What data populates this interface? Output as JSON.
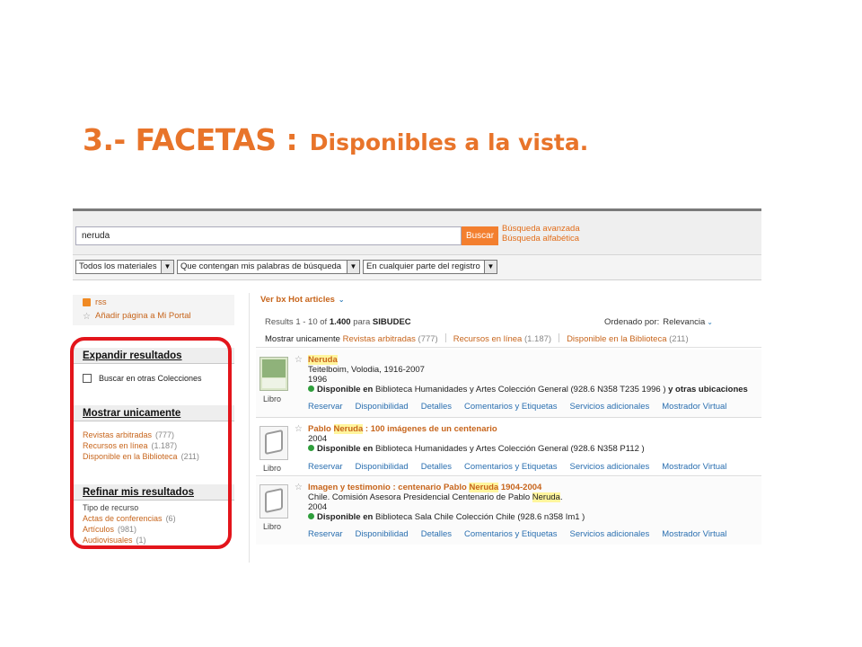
{
  "slide": {
    "title": "3.- FACETAS :",
    "subtitle": "Disponibles a la vista."
  },
  "search": {
    "query": "neruda",
    "button": "Buscar",
    "links": [
      "Búsqueda avanzada",
      "Búsqueda alfabética"
    ],
    "selects": [
      "Todos los materiales",
      "Que contengan mis palabras de búsqueda",
      "En cualquier parte del registro"
    ]
  },
  "sidebar": {
    "rss": "rss",
    "portal": "Añadir página a Mi Portal",
    "expand": {
      "heading": "Expandir resultados",
      "checkbox_label": "Buscar en otras Colecciones"
    },
    "show_only": {
      "heading": "Mostrar unicamente",
      "items": [
        {
          "label": "Revistas arbitradas",
          "count": "(777)"
        },
        {
          "label": "Recursos en línea",
          "count": "(1.187)"
        },
        {
          "label": "Disponible en la Biblioteca",
          "count": "(211)"
        }
      ]
    },
    "refine": {
      "heading": "Refinar mis resultados",
      "group": "Tipo de recurso",
      "items": [
        {
          "label": "Actas de conferencias",
          "count": "(6)"
        },
        {
          "label": "Artículos",
          "count": "(981)"
        },
        {
          "label": "Audiovisuales",
          "count": "(1)"
        }
      ]
    }
  },
  "results_header": {
    "hot": "Ver bx Hot articles",
    "count_prefix": "Results 1 - 10 of",
    "total": "1.400",
    "count_para": "para",
    "source": "SIBUDEC",
    "sort_label": "Ordenado por:",
    "sort_value": "Relevancia",
    "filter_label": "Mostrar unicamente",
    "filters": [
      {
        "label": "Revistas arbitradas",
        "count": "(777)"
      },
      {
        "label": "Recursos en línea",
        "count": "(1.187)"
      },
      {
        "label": "Disponible en la Biblioteca",
        "count": "(211)"
      }
    ]
  },
  "results": [
    {
      "title_parts": [
        "",
        "Neruda",
        ""
      ],
      "lines": [
        [
          "Teitelboim, Volodia, 1916-2007"
        ],
        [
          "1996"
        ]
      ],
      "availability": {
        "label": "Disponible en",
        "text": "Biblioteca Humanidades y Artes Colección General (928.6 N358 T235 1996 )",
        "extra": "y otras ubicaciones"
      },
      "type": "Libro"
    },
    {
      "title_parts": [
        "Pablo ",
        "Neruda",
        " : 100 imágenes de un centenario"
      ],
      "lines": [
        [
          "2004"
        ]
      ],
      "availability": {
        "label": "Disponible en",
        "text": "Biblioteca Humanidades y Artes Colección General (928.6 N358 P112 )",
        "extra": ""
      },
      "type": "Libro"
    },
    {
      "title_parts": [
        "Imagen y testimonio : centenario Pablo ",
        "Neruda",
        " 1904-2004"
      ],
      "lines": [
        [
          "Chile. Comisión Asesora Presidencial Centenario de Pablo ",
          "Neruda",
          "."
        ],
        [
          "2004"
        ]
      ],
      "availability": {
        "label": "Disponible en",
        "text": "Biblioteca Sala Chile Colección Chile (928.6 n358 Im1 )",
        "extra": ""
      },
      "type": "Libro"
    }
  ],
  "actions": [
    "Reservar",
    "Disponibilidad",
    "Detalles",
    "Comentarios y Etiquetas",
    "Servicios adicionales",
    "Mostrador Virtual"
  ],
  "colors": {
    "title": "#e8742a",
    "link": "#c7651c",
    "action": "#2a6fb0",
    "highlight": "#fff59d",
    "ring": "#e3151b"
  }
}
